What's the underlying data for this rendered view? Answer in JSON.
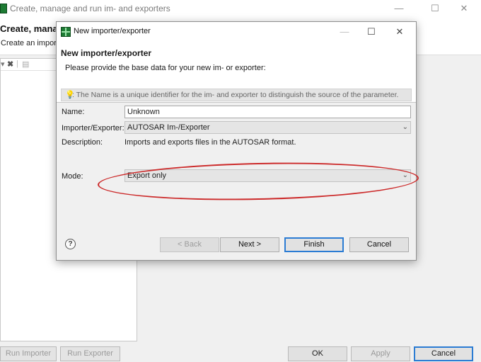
{
  "background_window": {
    "title": "Create, manage and run im- and exporters",
    "window_controls": {
      "minimize": "—",
      "maximize": "☐",
      "close": "✕"
    },
    "header_title": "Create, manage",
    "header_description": "Create an import",
    "buttons": {
      "run_importer": "Run Importer",
      "run_exporter": "Run Exporter",
      "ok": "OK",
      "apply": "Apply",
      "cancel": "Cancel"
    }
  },
  "dialog": {
    "title": "New importer/exporter",
    "window_controls": {
      "minimize": "—",
      "maximize": "☐",
      "close": "✕"
    },
    "header_title": "New importer/exporter",
    "header_description": "Please provide the base data for your new im- or exporter:",
    "info_text": ": The Name is a unique identifier for the im- and exporter to distinguish the source of the parameter.",
    "fields": {
      "name_label": "Name:",
      "name_value": "Unknown",
      "importer_label": "Importer/Exporter:",
      "importer_value": "AUTOSAR Im-/Exporter",
      "description_label": "Description:",
      "description_value": "Imports and exports files in the AUTOSAR format.",
      "mode_label": "Mode:",
      "mode_value": "Export only"
    },
    "buttons": {
      "back": "< Back",
      "next": "Next >",
      "finish": "Finish",
      "cancel": "Cancel"
    },
    "highlight_color": "#cc2a2a"
  }
}
